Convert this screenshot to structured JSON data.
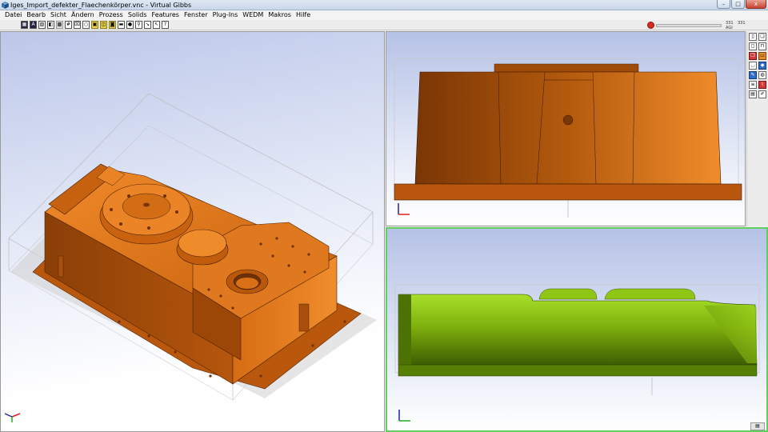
{
  "window": {
    "title": "Iges_Import_defekter_Flaechenkörper.vnc - Virtual Gibbs",
    "app_icon": "cube-icon",
    "buttons": {
      "minimize": "–",
      "maximize": "□",
      "close": "x"
    }
  },
  "menu": {
    "items": [
      "Datei",
      "Bearb",
      "Sicht",
      "Ändern",
      "Prozess",
      "Solids",
      "Features",
      "Fenster",
      "Plug-Ins",
      "WEDM",
      "Makros",
      "Hilfe"
    ]
  },
  "toolbar": {
    "buttons": [
      {
        "icon": "wireframe-icon",
        "glyph": "▦",
        "style": "dark"
      },
      {
        "icon": "shaded-icon",
        "glyph": "A",
        "style": "dark"
      },
      {
        "icon": "hidden-line-icon",
        "glyph": "▨",
        "style": "plain"
      },
      {
        "icon": "shade-icon",
        "glyph": "◧",
        "style": "plain"
      },
      {
        "icon": "solid-icon",
        "glyph": "▩",
        "style": "g"
      },
      {
        "icon": "grid-icon",
        "glyph": "#",
        "style": "plain"
      },
      {
        "icon": "dimension-icon",
        "glyph": "⌧",
        "style": "plain"
      },
      {
        "icon": "circle-icon",
        "glyph": "○",
        "style": "plain"
      },
      {
        "icon": "yellow-box-icon",
        "glyph": "▣",
        "style": "y"
      },
      {
        "icon": "layer-icon",
        "glyph": "◫",
        "style": "y"
      },
      {
        "icon": "cylinder-icon",
        "glyph": "◙",
        "style": "y"
      },
      {
        "icon": "sheet-icon",
        "glyph": "▬",
        "style": "plain"
      },
      {
        "icon": "disc-icon",
        "glyph": "●",
        "style": "plain"
      },
      {
        "icon": "tool-icon",
        "glyph": "⚲",
        "style": "plain"
      },
      {
        "icon": "arrow-icon",
        "glyph": "↘",
        "style": "plain"
      },
      {
        "icon": "pointer-icon",
        "glyph": "↖",
        "style": "plain"
      },
      {
        "icon": "help-pointer-icon",
        "glyph": "?",
        "style": "plain"
      }
    ],
    "stop_icon": "stop-icon",
    "coords": [
      "331",
      "331",
      "AGI"
    ]
  },
  "palette": {
    "col1": [
      {
        "icon": "new-document-icon",
        "glyph": "▯",
        "style": "plain"
      },
      {
        "icon": "rect-select-icon",
        "glyph": "◻",
        "style": "plain"
      },
      {
        "icon": "multi-doc-icon",
        "glyph": "❐",
        "style": "r"
      },
      {
        "icon": "bowl-icon",
        "glyph": "◡",
        "style": "plain"
      },
      {
        "icon": "brush-icon",
        "glyph": "✎",
        "style": "b"
      },
      {
        "icon": "text-tool-icon",
        "glyph": "≡",
        "style": "plain"
      },
      {
        "icon": "machine-icon",
        "glyph": "▤",
        "style": "plain"
      }
    ],
    "col2": [
      {
        "icon": "copy-icon",
        "glyph": "❏",
        "style": "plain"
      },
      {
        "icon": "vise-icon",
        "glyph": "⊓",
        "style": "plain"
      },
      {
        "icon": "stock-icon",
        "glyph": "▭",
        "style": "o"
      },
      {
        "icon": "plate-icon",
        "glyph": "◆",
        "style": "b"
      },
      {
        "icon": "ring-icon",
        "glyph": "◍",
        "style": "plain"
      },
      {
        "icon": "graph-tool-icon",
        "glyph": "⌇",
        "style": "r"
      },
      {
        "icon": "edit-tool-icon",
        "glyph": "✐",
        "style": "plain"
      }
    ]
  },
  "colors": {
    "part_orange": "#d26a14",
    "part_orange_dark": "#8a3e07",
    "part_green": "#7fb10d",
    "part_green_dark": "#3e5d02",
    "active_border": "#5fd05f"
  }
}
